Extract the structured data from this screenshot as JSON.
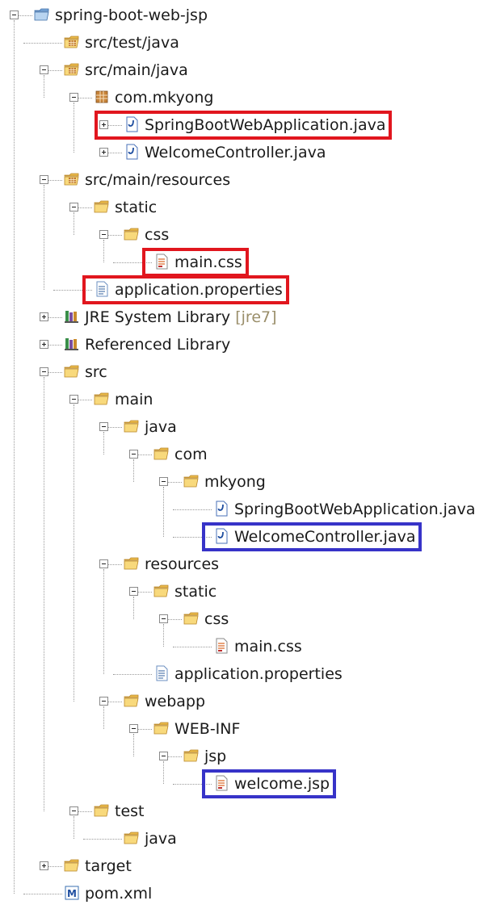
{
  "colors": {
    "highlight_red": "#e1161e",
    "highlight_blue": "#3733c8",
    "folder": "#f3cf6a"
  },
  "tree": [
    {
      "label": "spring-boot-web-jsp",
      "icon": "project-folder-icon",
      "toggle": "minus"
    },
    {
      "label": "src/test/java",
      "icon": "source-folder-icon",
      "toggle": "none"
    },
    {
      "label": "src/main/java",
      "icon": "source-folder-icon",
      "toggle": "minus"
    },
    {
      "label": "com.mkyong",
      "icon": "package-icon",
      "toggle": "minus"
    },
    {
      "label": "SpringBootWebApplication.java",
      "icon": "java-file-icon",
      "toggle": "plus",
      "highlight": "red"
    },
    {
      "label": "WelcomeController.java",
      "icon": "java-file-icon",
      "toggle": "plus"
    },
    {
      "label": "src/main/resources",
      "icon": "source-folder-icon",
      "toggle": "minus"
    },
    {
      "label": "static",
      "icon": "folder-icon",
      "toggle": "minus"
    },
    {
      "label": "css",
      "icon": "folder-icon",
      "toggle": "minus"
    },
    {
      "label": "main.css",
      "icon": "css-file-icon",
      "toggle": "none",
      "highlight": "red"
    },
    {
      "label": "application.properties",
      "icon": "properties-file-icon",
      "toggle": "none",
      "highlight": "red"
    },
    {
      "label": "JRE System Library",
      "decoration": "[jre7]",
      "icon": "library-icon",
      "toggle": "plus"
    },
    {
      "label": "Referenced Library",
      "icon": "library-icon",
      "toggle": "plus"
    },
    {
      "label": "src",
      "icon": "folder-icon",
      "toggle": "minus"
    },
    {
      "label": "main",
      "icon": "folder-icon",
      "toggle": "minus"
    },
    {
      "label": "java",
      "icon": "folder-icon",
      "toggle": "minus"
    },
    {
      "label": "com",
      "icon": "folder-icon",
      "toggle": "minus"
    },
    {
      "label": "mkyong",
      "icon": "folder-icon",
      "toggle": "minus"
    },
    {
      "label": "SpringBootWebApplication.java",
      "icon": "java-file-icon",
      "toggle": "none"
    },
    {
      "label": "WelcomeController.java",
      "icon": "java-file-icon",
      "toggle": "none",
      "highlight": "blue"
    },
    {
      "label": "resources",
      "icon": "folder-icon",
      "toggle": "minus"
    },
    {
      "label": "static",
      "icon": "folder-icon",
      "toggle": "minus"
    },
    {
      "label": "css",
      "icon": "folder-icon",
      "toggle": "minus"
    },
    {
      "label": "main.css",
      "icon": "css-file-icon",
      "toggle": "none"
    },
    {
      "label": "application.properties",
      "icon": "properties-file-icon",
      "toggle": "none"
    },
    {
      "label": "webapp",
      "icon": "folder-icon",
      "toggle": "minus"
    },
    {
      "label": "WEB-INF",
      "icon": "folder-icon",
      "toggle": "minus"
    },
    {
      "label": "jsp",
      "icon": "folder-icon",
      "toggle": "minus"
    },
    {
      "label": "welcome.jsp",
      "icon": "jsp-file-icon",
      "toggle": "none",
      "highlight": "blue"
    },
    {
      "label": "test",
      "icon": "folder-icon",
      "toggle": "minus"
    },
    {
      "label": "java",
      "icon": "folder-icon",
      "toggle": "none"
    },
    {
      "label": "target",
      "icon": "folder-icon",
      "toggle": "plus"
    },
    {
      "label": "pom.xml",
      "icon": "maven-pom-icon",
      "toggle": "none"
    }
  ]
}
